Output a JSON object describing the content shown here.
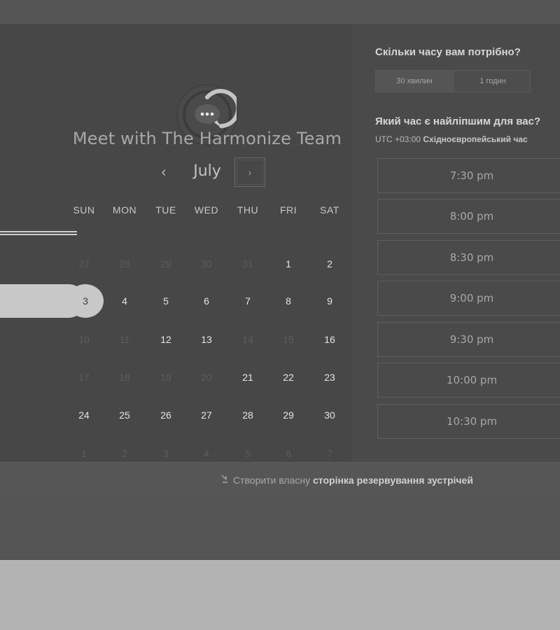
{
  "header": {
    "title": "Meet with The Harmonize Team"
  },
  "calendar": {
    "month": "July",
    "prev_icon": "chevron-left-icon",
    "next_icon": "chevron-right-icon",
    "prev_glyph": "‹",
    "next_glyph": "›",
    "weekdays": [
      "SUN",
      "MON",
      "TUE",
      "WED",
      "THU",
      "FRI",
      "SAT"
    ],
    "weeks": [
      [
        "27",
        "28",
        "29",
        "30",
        "31",
        "1",
        "2"
      ],
      [
        "3",
        "4",
        "5",
        "6",
        "7",
        "8",
        "9"
      ],
      [
        "10",
        "11",
        "12",
        "13",
        "14",
        "15",
        "16"
      ],
      [
        "17",
        "18",
        "19",
        "20",
        "21",
        "22",
        "23"
      ],
      [
        "24",
        "25",
        "26",
        "27",
        "28",
        "29",
        "30"
      ],
      [
        "1",
        "2",
        "3",
        "4",
        "5",
        "6",
        "7"
      ]
    ],
    "selected_day": "3"
  },
  "booking": {
    "duration_question": "Скільки часу вам потрібно?",
    "durations": [
      "30 хвилин",
      "1 годин"
    ],
    "time_question": "Який час є найліпшим для вас?",
    "timezone_offset": "UTC +03:00",
    "timezone_name": "Східноєвропейський час",
    "slots": [
      "7:30 pm",
      "8:00 pm",
      "8:30 pm",
      "9:00 pm",
      "9:30 pm",
      "10:00 pm",
      "10:30 pm"
    ]
  },
  "footer": {
    "link_prefix": "Створити власну",
    "link_bold": "сторінка резервування зустрічей",
    "icon": "link-arrow-icon"
  },
  "colors": {
    "selected": "#c8c8c8",
    "panel": "#474747",
    "background": "#b3b3b3"
  }
}
